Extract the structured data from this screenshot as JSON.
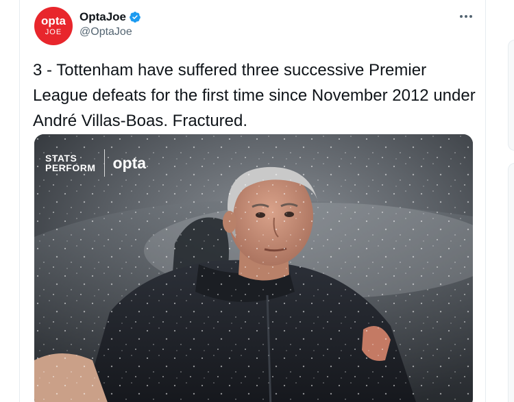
{
  "author": {
    "display_name": "OptaJoe",
    "handle": "@OptaJoe",
    "verified": true,
    "avatar": {
      "top_text": "opta",
      "bottom_text": "JOE",
      "color": "#e8262c"
    }
  },
  "tweet": {
    "text": "3 - Tottenham have suffered three successive Premier League defeats for the first time since November 2012 under André Villas-Boas. Fractured."
  },
  "media": {
    "watermark": {
      "brand_left_line1": "STATS",
      "brand_left_line2": "PERFORM",
      "brand_right": "opta"
    }
  },
  "icons": {
    "verified": "verified-badge-icon",
    "more": "more-horizontal-icon"
  },
  "colors": {
    "verified": "#1d9bf0",
    "text": "#0f1419",
    "secondary_text": "#536471"
  }
}
